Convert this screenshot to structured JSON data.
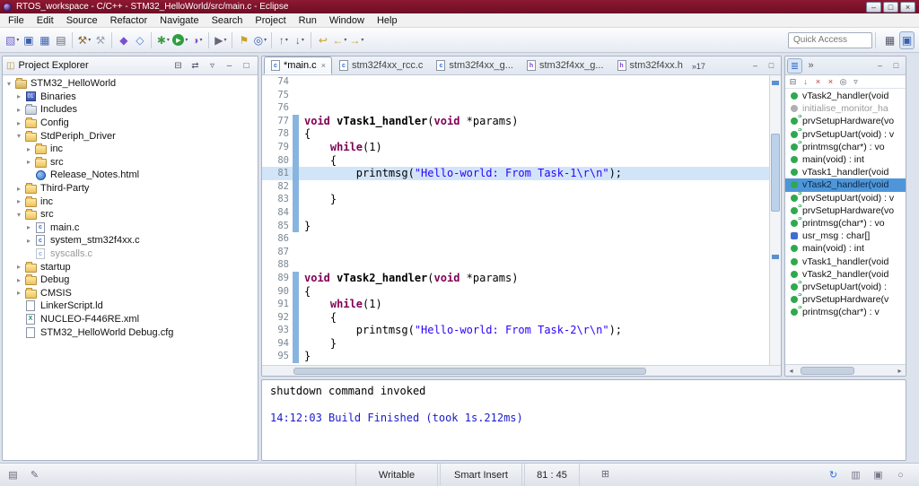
{
  "colors": {
    "titlebar": "#7a1028",
    "keyword": "#7f0055",
    "string_literal": "#2a00ff",
    "console_info": "#1a1acd",
    "selection": "#4e96d9",
    "current_line": "#d2e5f8",
    "change_bar": "#88b5e0"
  },
  "window": {
    "title": "RTOS_workspace - C/C++ - STM32_HelloWorld/src/main.c - Eclipse",
    "controls": [
      {
        "name": "minimize-window-button",
        "glyph": "–"
      },
      {
        "name": "maximize-window-button",
        "glyph": "□"
      },
      {
        "name": "close-window-button",
        "glyph": "×"
      }
    ]
  },
  "menu": [
    "File",
    "Edit",
    "Source",
    "Refactor",
    "Navigate",
    "Search",
    "Project",
    "Run",
    "Window",
    "Help"
  ],
  "toolbar": {
    "quick_access": "Quick Access",
    "icons": [
      {
        "name": "new-button",
        "glyph": "▧",
        "color": "#6f63c9",
        "dd": true
      },
      {
        "name": "save-button",
        "glyph": "▣",
        "color": "#3a5fae"
      },
      {
        "name": "save-all-button",
        "glyph": "▦",
        "color": "#3a5fae"
      },
      {
        "name": "print-button",
        "glyph": "▤",
        "color": "#667"
      },
      {
        "sep": true
      },
      {
        "name": "build-all-button",
        "glyph": "⚒",
        "color": "#8a6a3a",
        "dd": true
      },
      {
        "name": "build-project-button",
        "glyph": "⚒",
        "color": "#9aa4b0"
      },
      {
        "sep": true
      },
      {
        "name": "new-cpp-wizard-button",
        "glyph": "◆",
        "color": "#7a4fd0"
      },
      {
        "name": "new-class-wizard-button",
        "glyph": "◇",
        "color": "#4f7ad0"
      },
      {
        "sep": true
      },
      {
        "name": "debug-button",
        "glyph": "✱",
        "color": "#3f9b45",
        "dd": true
      },
      {
        "name": "run-button",
        "glyph": "▶",
        "color": "#fff",
        "circle": true,
        "dd": true
      },
      {
        "name": "profile-button",
        "glyph": "◑",
        "color": "#8a4fd0",
        "dd": true
      },
      {
        "sep": true
      },
      {
        "name": "external-tools-button",
        "glyph": "▶",
        "color": "#667",
        "dd": true
      },
      {
        "sep": true
      },
      {
        "name": "mark-occurrences-button",
        "glyph": "⚑",
        "color": "#c9a227"
      },
      {
        "name": "search-button",
        "glyph": "◎",
        "color": "#3a5fae",
        "dd": true
      },
      {
        "sep": true
      },
      {
        "name": "previous-annotation-button",
        "glyph": "↑",
        "color": "#667",
        "dd": true
      },
      {
        "name": "next-annotation-button",
        "glyph": "↓",
        "color": "#667",
        "dd": true
      },
      {
        "sep": true
      },
      {
        "name": "last-edit-location-button",
        "glyph": "↩",
        "color": "#c9a227"
      },
      {
        "name": "back-button",
        "glyph": "←",
        "color": "#c9a227",
        "dd": true
      },
      {
        "name": "forward-button",
        "glyph": "→",
        "color": "#c9a227",
        "dd": true
      }
    ],
    "perspective_icons": [
      {
        "name": "open-perspective-button",
        "glyph": "▦",
        "color": "#556"
      },
      {
        "name": "cpp-perspective-button",
        "glyph": "▣",
        "color": "#3a5fae",
        "active": true
      }
    ]
  },
  "project_explorer": {
    "title": "Project Explorer",
    "icon_glyph": "◫",
    "header_icons": [
      {
        "name": "collapse-all-button",
        "glyph": "⊟",
        "color": "#556"
      },
      {
        "name": "link-with-editor-button",
        "glyph": "⇄",
        "color": "#556"
      },
      {
        "name": "view-menu-button",
        "glyph": "▿",
        "color": "#556"
      },
      {
        "name": "minimize-view-button",
        "glyph": "–",
        "color": "#556"
      },
      {
        "name": "maximize-view-button",
        "glyph": "□",
        "color": "#556"
      }
    ],
    "tree": [
      {
        "label": "STM32_HelloWorld",
        "level": 0,
        "icon": "project",
        "arrow": "exp"
      },
      {
        "label": "Binaries",
        "level": 1,
        "icon": "binaries",
        "arrow": "col"
      },
      {
        "label": "Includes",
        "level": 1,
        "icon": "includes",
        "arrow": "col"
      },
      {
        "label": "Config",
        "level": 1,
        "icon": "folder",
        "arrow": "col"
      },
      {
        "label": "StdPeriph_Driver",
        "level": 1,
        "icon": "folder",
        "arrow": "exp"
      },
      {
        "label": "inc",
        "level": 2,
        "icon": "folder",
        "arrow": "col"
      },
      {
        "label": "src",
        "level": 2,
        "icon": "folder",
        "arrow": "col"
      },
      {
        "label": "Release_Notes.html",
        "level": 2,
        "icon": "html"
      },
      {
        "label": "Third-Party",
        "level": 1,
        "icon": "folder",
        "arrow": "col"
      },
      {
        "label": "inc",
        "level": 1,
        "icon": "folder",
        "arrow": "col"
      },
      {
        "label": "src",
        "level": 1,
        "icon": "folder",
        "arrow": "exp"
      },
      {
        "label": "main.c",
        "level": 2,
        "icon": "cfile",
        "arrow": "col"
      },
      {
        "label": "system_stm32f4xx.c",
        "level": 2,
        "icon": "cfile",
        "arrow": "col"
      },
      {
        "label": "syscalls.c",
        "level": 2,
        "icon": "cfile",
        "gray": true
      },
      {
        "label": "startup",
        "level": 1,
        "icon": "folder",
        "arrow": "col"
      },
      {
        "label": "Debug",
        "level": 1,
        "icon": "folder",
        "arrow": "col"
      },
      {
        "label": "CMSIS",
        "level": 1,
        "icon": "folder",
        "arrow": "col"
      },
      {
        "label": "LinkerScript.ld",
        "level": 1,
        "icon": "doc"
      },
      {
        "label": "NUCLEO-F446RE.xml",
        "level": 1,
        "icon": "xml"
      },
      {
        "label": "STM32_HelloWorld Debug.cfg",
        "level": 1,
        "icon": "doc"
      }
    ]
  },
  "editor": {
    "tabs": [
      {
        "label": "*main.c",
        "icon": "c",
        "active": true
      },
      {
        "label": "stm32f4xx_rcc.c",
        "icon": "c"
      },
      {
        "label": "stm32f4xx_g...",
        "icon": "c"
      },
      {
        "label": "stm32f4xx_g...",
        "icon": "h"
      },
      {
        "label": "stm32f4xx.h",
        "icon": "h"
      }
    ],
    "overflow_label": "»17",
    "tab_actions": [
      {
        "name": "minimize-editor-button",
        "glyph": "–",
        "color": "#556"
      },
      {
        "name": "maximize-editor-button",
        "glyph": "□",
        "color": "#556"
      }
    ],
    "lines": [
      {
        "n": 74,
        "seg": []
      },
      {
        "n": 75,
        "seg": []
      },
      {
        "n": 76,
        "seg": []
      },
      {
        "n": 77,
        "chg": true,
        "seg": [
          [
            "kw",
            "void"
          ],
          [
            "p",
            " "
          ],
          [
            "fn",
            "vTask1_handler"
          ],
          [
            "p",
            "("
          ],
          [
            "kw",
            "void"
          ],
          [
            "p",
            " *params)"
          ]
        ]
      },
      {
        "n": 78,
        "chg": true,
        "seg": [
          [
            "p",
            "{"
          ]
        ]
      },
      {
        "n": 79,
        "chg": true,
        "seg": [
          [
            "p",
            "    "
          ],
          [
            "kw",
            "while"
          ],
          [
            "p",
            "(1)"
          ]
        ]
      },
      {
        "n": 80,
        "chg": true,
        "seg": [
          [
            "p",
            "    {"
          ]
        ]
      },
      {
        "n": 81,
        "chg": true,
        "hl": true,
        "seg": [
          [
            "p",
            "        printmsg("
          ],
          [
            "str",
            "\"Hello-world: From Task-1\\r\\n\""
          ],
          [
            "p",
            ");"
          ]
        ]
      },
      {
        "n": 82,
        "chg": true,
        "seg": []
      },
      {
        "n": 83,
        "chg": true,
        "seg": [
          [
            "p",
            "    }"
          ]
        ]
      },
      {
        "n": 84,
        "chg": true,
        "seg": []
      },
      {
        "n": 85,
        "chg": true,
        "seg": [
          [
            "p",
            "}"
          ]
        ]
      },
      {
        "n": 86,
        "seg": []
      },
      {
        "n": 87,
        "seg": []
      },
      {
        "n": 88,
        "seg": []
      },
      {
        "n": 89,
        "chg": true,
        "seg": [
          [
            "kw",
            "void"
          ],
          [
            "p",
            " "
          ],
          [
            "fn",
            "vTask2_handler"
          ],
          [
            "p",
            "("
          ],
          [
            "kw",
            "void"
          ],
          [
            "p",
            " *params)"
          ]
        ]
      },
      {
        "n": 90,
        "chg": true,
        "seg": [
          [
            "p",
            "{"
          ]
        ]
      },
      {
        "n": 91,
        "chg": true,
        "seg": [
          [
            "p",
            "    "
          ],
          [
            "kw",
            "while"
          ],
          [
            "p",
            "(1)"
          ]
        ]
      },
      {
        "n": 92,
        "chg": true,
        "seg": [
          [
            "p",
            "    {"
          ]
        ]
      },
      {
        "n": 93,
        "chg": true,
        "seg": [
          [
            "p",
            "        printmsg("
          ],
          [
            "str",
            "\"Hello-world: From Task-2\\r\\n\""
          ],
          [
            "p",
            ");"
          ]
        ]
      },
      {
        "n": 94,
        "chg": true,
        "seg": [
          [
            "p",
            "    }"
          ]
        ]
      },
      {
        "n": 95,
        "chg": true,
        "seg": [
          [
            "p",
            "}"
          ]
        ]
      }
    ]
  },
  "outline": {
    "tabs": [
      {
        "name": "outline-view-tab",
        "glyph": "≣",
        "color": "#3a6fd0",
        "active": true
      },
      {
        "name": "hidden-views-button",
        "glyph": "»",
        "color": "#556"
      }
    ],
    "tab_actions": [
      {
        "name": "minimize-view-button",
        "glyph": "–",
        "color": "#556"
      },
      {
        "name": "maximize-view-button",
        "glyph": "□",
        "color": "#556"
      }
    ],
    "toolbar": [
      {
        "name": "collapse-all-button",
        "glyph": "⊟",
        "color": "#556"
      },
      {
        "name": "sort-button",
        "glyph": "↓",
        "color": "#3a6fd0"
      },
      {
        "name": "hide-fields-button",
        "glyph": "×",
        "color": "#b33"
      },
      {
        "name": "hide-static-members-button",
        "glyph": "×",
        "color": "#b33"
      },
      {
        "name": "hide-non-public-button",
        "glyph": "◎",
        "color": "#556"
      },
      {
        "name": "view-menu-button",
        "glyph": "▿",
        "color": "#556"
      }
    ],
    "scroll_left_glyph": "◂",
    "scroll_right_glyph": "▸",
    "items": [
      {
        "label": "vTask2_handler(void",
        "icon": "method"
      },
      {
        "label": "initialise_monitor_ha",
        "icon": "method-gray",
        "gray": true
      },
      {
        "label": "prvSetupHardware(vo",
        "icon": "method-static"
      },
      {
        "label": "prvSetupUart(void) : v",
        "icon": "method-static"
      },
      {
        "label": "printmsg(char*) : vo",
        "icon": "method-static"
      },
      {
        "label": "main(void) : int",
        "icon": "method"
      },
      {
        "label": "vTask1_handler(void",
        "icon": "method"
      },
      {
        "label": "vTask2_handler(void",
        "icon": "method",
        "sel": true
      },
      {
        "label": "prvSetupUart(void) : v",
        "icon": "method-static"
      },
      {
        "label": "prvSetupHardware(vo",
        "icon": "method-static"
      },
      {
        "label": "printmsg(char*) : vo",
        "icon": "method-static"
      },
      {
        "label": "usr_msg : char[]",
        "icon": "field"
      },
      {
        "label": "main(void) : int",
        "icon": "method"
      },
      {
        "label": "vTask1_handler(void",
        "icon": "method"
      },
      {
        "label": "vTask2_handler(void",
        "icon": "method"
      },
      {
        "label": "prvSetupUart(void) :",
        "icon": "method-static"
      },
      {
        "label": "prvSetupHardware(v",
        "icon": "method-static"
      },
      {
        "label": "printmsg(char*) : v",
        "icon": "method-static"
      }
    ]
  },
  "console": {
    "lines": [
      {
        "text": "shutdown command invoked",
        "style": "plain"
      },
      {
        "text": "",
        "style": "plain"
      },
      {
        "text": "14:12:03 Build Finished (took 1s.212ms)",
        "style": "info"
      }
    ]
  },
  "status_bar": {
    "left_icons": [
      {
        "name": "show-selected-element-icon",
        "glyph": "▤",
        "color": "#667"
      },
      {
        "name": "edit-mode-icon",
        "glyph": "✎",
        "color": "#667"
      }
    ],
    "writable": "Writable",
    "insert_mode": "Smart Insert",
    "position": "81 : 45",
    "mid_icon": {
      "name": "input-method-icon",
      "glyph": "⊞",
      "color": "#667"
    },
    "right_icons": [
      {
        "name": "sync-icon",
        "glyph": "↻",
        "color": "#3a6fd0"
      },
      {
        "name": "memory-monitor-icon",
        "glyph": "▥",
        "color": "#778"
      },
      {
        "name": "notification-icon",
        "glyph": "▣",
        "color": "#778"
      },
      {
        "name": "progress-view-icon",
        "glyph": "○",
        "color": "#778"
      }
    ]
  }
}
